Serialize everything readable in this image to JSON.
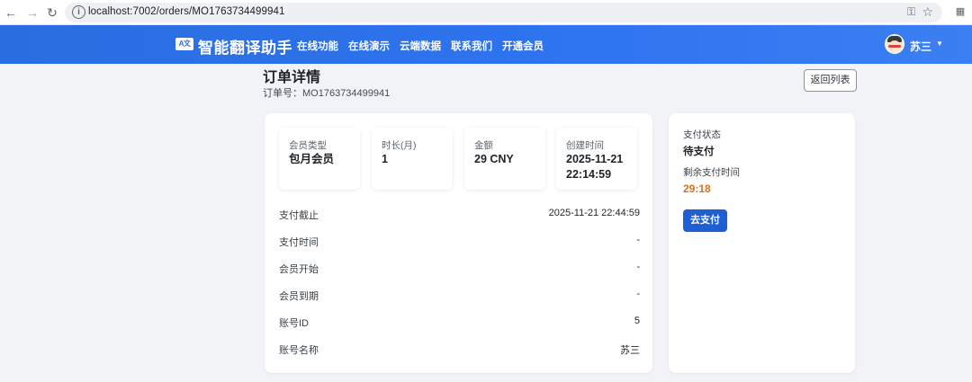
{
  "browser": {
    "url": "localhost:7002/orders/MO1763734499941"
  },
  "app": {
    "logo_badge": "A文",
    "brand": "智能翻译助手",
    "nav": [
      "在线功能",
      "在线演示",
      "云端数据",
      "联系我们",
      "开通会员"
    ],
    "user_name": "苏三",
    "accent_color": "#2f74f0"
  },
  "page": {
    "title": "订单详情",
    "order_no_label": "订单号：",
    "order_no": "MO1763734499941",
    "back_button": "返回列表"
  },
  "summary": [
    {
      "label": "会员类型",
      "value": "包月会员"
    },
    {
      "label": "时长(月)",
      "value": "1"
    },
    {
      "label": "金额",
      "value": "29 CNY"
    },
    {
      "label": "创建时间",
      "value": "2025-11-21 22:14:59"
    }
  ],
  "details": [
    {
      "label": "支付截止",
      "value": "2025-11-21 22:44:59"
    },
    {
      "label": "支付时间",
      "value": "-"
    },
    {
      "label": "会员开始",
      "value": "-"
    },
    {
      "label": "会员到期",
      "value": "-"
    },
    {
      "label": "账号ID",
      "value": "5"
    },
    {
      "label": "账号名称",
      "value": "苏三"
    }
  ],
  "payment": {
    "status_label": "支付状态",
    "status": "待支付",
    "remaining_label": "剩余支付时间",
    "remaining": "29:18",
    "pay_button": "去支付",
    "timer_color": "#d2741f"
  }
}
